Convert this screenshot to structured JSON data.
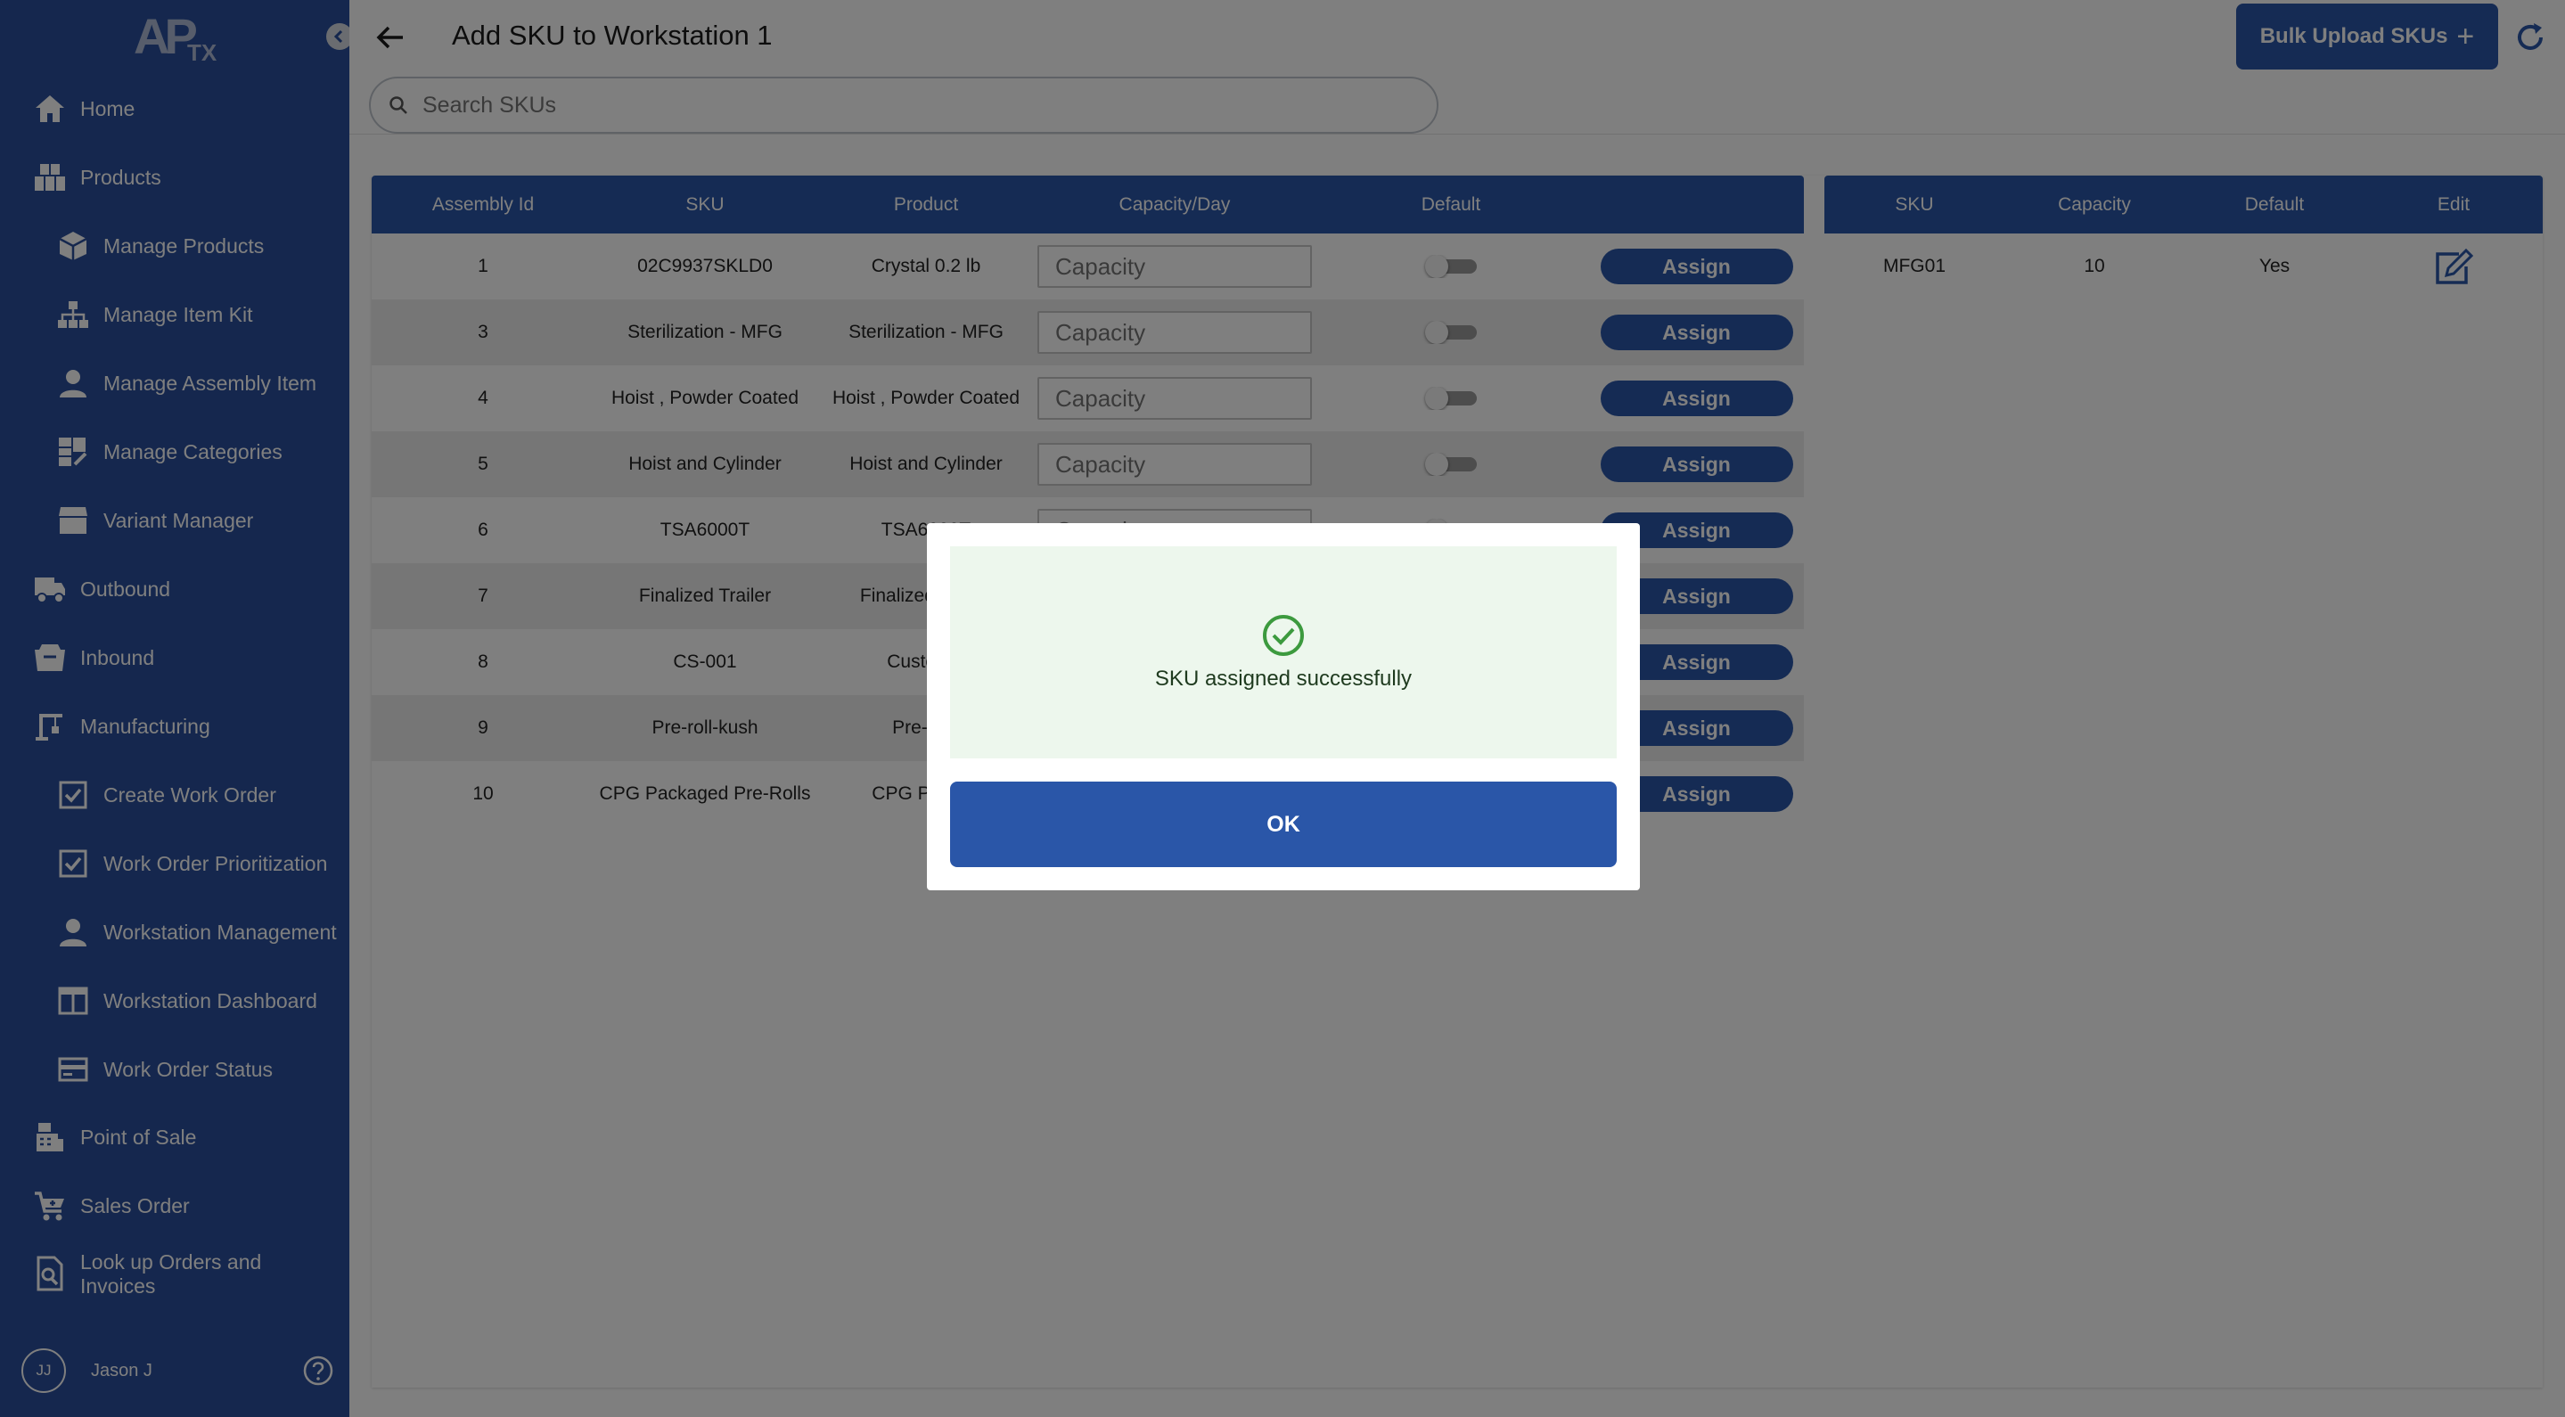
{
  "app": {
    "logo_text": "APTX"
  },
  "sidebar": {
    "items": [
      {
        "label": "Home",
        "icon": "home-icon"
      },
      {
        "label": "Products",
        "icon": "products-icon"
      },
      {
        "label": "Manage Products",
        "icon": "cube-icon"
      },
      {
        "label": "Manage Item Kit",
        "icon": "hierarchy-icon"
      },
      {
        "label": "Manage Assembly Item",
        "icon": "person-icon"
      },
      {
        "label": "Manage Categories",
        "icon": "categories-icon"
      },
      {
        "label": "Variant Manager",
        "icon": "package-icon"
      },
      {
        "label": "Outbound",
        "icon": "truck-icon"
      },
      {
        "label": "Inbound",
        "icon": "box-icon"
      },
      {
        "label": "Manufacturing",
        "icon": "crane-icon"
      },
      {
        "label": "Create Work Order",
        "icon": "checkbox-icon"
      },
      {
        "label": "Work Order Prioritization",
        "icon": "checkbox-icon"
      },
      {
        "label": "Workstation Management",
        "icon": "person-icon"
      },
      {
        "label": "Workstation Dashboard",
        "icon": "dashboard-icon"
      },
      {
        "label": "Work Order Status",
        "icon": "card-icon"
      },
      {
        "label": "Point of Sale",
        "icon": "register-icon"
      },
      {
        "label": "Sales Order",
        "icon": "cart-icon"
      },
      {
        "label": "Look up Orders and Invoices",
        "icon": "search-document-icon"
      }
    ],
    "user": {
      "initials": "JJ",
      "name": "Jason J"
    }
  },
  "header": {
    "title": "Add SKU to Workstation 1",
    "bulk_upload_label": "Bulk Upload SKUs",
    "search_placeholder": "Search SKUs"
  },
  "sku_table": {
    "columns": [
      "Assembly Id",
      "SKU",
      "Product",
      "Capacity/Day",
      "Default",
      ""
    ],
    "capacity_placeholder": "Capacity",
    "assign_label": "Assign",
    "rows": [
      {
        "id": "1",
        "sku": "02C9937SKLD0",
        "product": "Crystal 0.2 lb"
      },
      {
        "id": "3",
        "sku": "Sterilization - MFG",
        "product": "Sterilization - MFG"
      },
      {
        "id": "4",
        "sku": "Hoist , Powder Coated",
        "product": "Hoist , Powder Coated"
      },
      {
        "id": "5",
        "sku": "Hoist and Cylinder",
        "product": "Hoist and Cylinder"
      },
      {
        "id": "6",
        "sku": "TSA6000T",
        "product": "TSA6000T"
      },
      {
        "id": "7",
        "sku": "Finalized Trailer",
        "product": "Finalized Trailer"
      },
      {
        "id": "8",
        "sku": "CS-001",
        "product": "Customiz"
      },
      {
        "id": "9",
        "sku": "Pre-roll-kush",
        "product": "Pre-Roll"
      },
      {
        "id": "10",
        "sku": "CPG Packaged Pre-Rolls",
        "product": "CPG Packag"
      }
    ]
  },
  "assigned_table": {
    "columns": [
      "SKU",
      "Capacity",
      "Default",
      "Edit"
    ],
    "rows": [
      {
        "sku": "MFG01",
        "capacity": "10",
        "default": "Yes"
      }
    ]
  },
  "modal": {
    "message": "SKU assigned successfully",
    "ok_label": "OK"
  },
  "colors": {
    "sidebar": "#2a4f9c",
    "accent": "#2a56a8",
    "success": "#3c9a3e",
    "success_bg": "#edf7ed"
  }
}
